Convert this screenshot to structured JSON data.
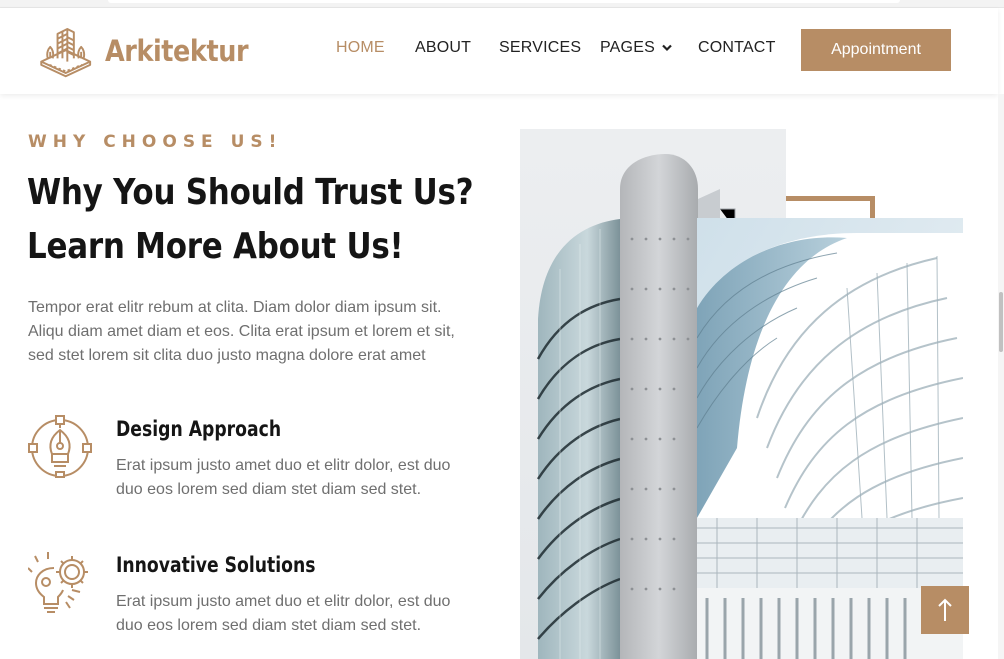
{
  "brand": {
    "name": "Arkitektur",
    "accent_color": "#b78d65",
    "logo_icon": "building-icon"
  },
  "nav": {
    "items": [
      {
        "label": "HOME",
        "active": true
      },
      {
        "label": "ABOUT",
        "active": false
      },
      {
        "label": "SERVICES",
        "active": false
      },
      {
        "label": "PAGES",
        "active": false,
        "dropdown": true
      },
      {
        "label": "CONTACT",
        "active": false
      }
    ],
    "cta_label": "Appointment"
  },
  "section": {
    "eyebrow": "WHY CHOOSE US!",
    "headline_line1": "Why You Should Trust Us?",
    "headline_line2": "Learn More About Us!",
    "intro": "Tempor erat elitr rebum at clita. Diam dolor diam ipsum sit. Aliqu diam amet diam et eos. Clita erat ipsum et lorem et sit, sed stet lorem sit clita duo justo magna dolore erat amet"
  },
  "features": [
    {
      "icon": "pen-tool-icon",
      "title": "Design Approach",
      "text": "Erat ipsum justo amet duo et elitr dolor, est duo duo eos lorem sed diam stet diam sed stet."
    },
    {
      "icon": "gear-bulb-icon",
      "title": "Innovative Solutions",
      "text": "Erat ipsum justo amet duo et elitr dolor, est duo duo eos lorem sed diam stet diam sed stet."
    }
  ],
  "images": {
    "back": "tower-building-photo",
    "front": "curved-building-photo"
  },
  "back_to_top_icon": "arrow-up-icon"
}
